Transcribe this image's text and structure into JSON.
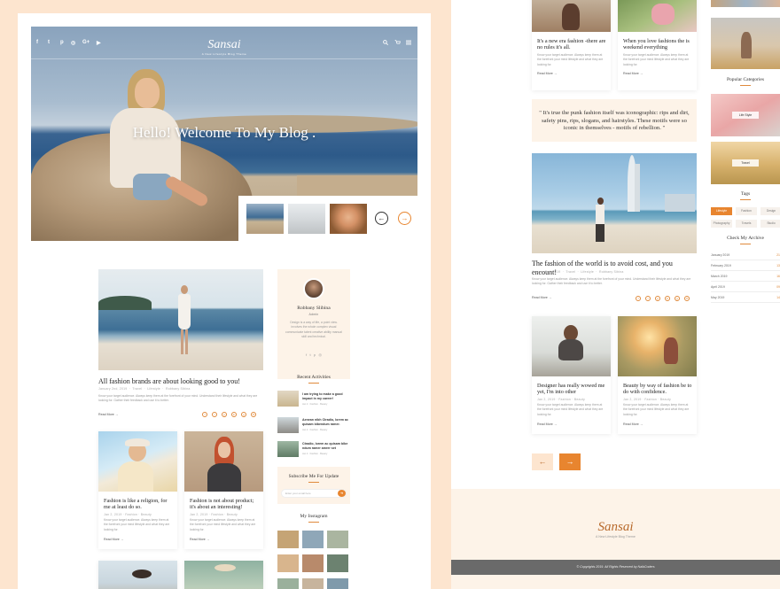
{
  "brand": {
    "logo": "Sansai",
    "tagline": "A New Lifestyle Blog Theme"
  },
  "colors": {
    "accent": "#e8852f",
    "peach": "#fde5cf",
    "cream": "#fdf3e8",
    "footer_bar": "#6a6a6a"
  },
  "header": {
    "social": [
      "f",
      "t",
      "p",
      "◎",
      "G+",
      "▶"
    ],
    "icons": [
      "search-icon",
      "cart-icon",
      "menu-icon"
    ],
    "cart_count": "0"
  },
  "hero": {
    "title": "Hello! Welcome To My Blog ."
  },
  "posts": {
    "p1": {
      "title": "All fashion brands are about looking good to you!",
      "meta": [
        "January 2nd, 2019",
        "Travel",
        "Lifestyle",
        "Robbany Sibina"
      ],
      "excerpt": "Know your target audience. Always keep them at the forefront of your mind. Understand their lifestyle and what they are looking for. Gather their feedback and use it to better.",
      "read_more": "Read More →",
      "share": [
        "f",
        "t",
        "p",
        "in",
        "g",
        "✉"
      ]
    },
    "c1": {
      "title": "Fashion is like a religion, for me at least do so.",
      "excerpt": "Know your target audience. Always keep them at the forefront your mind lifestyle and what they are looking for.",
      "read_more": "Read More →"
    },
    "c2": {
      "title": "Fashion is not about product; it's about an interesting!",
      "excerpt": "Know your target audience. Always keep them at the forefront your mind lifestyle and what they are looking for.",
      "read_more": "Read More →"
    },
    "r1": {
      "title": "It's a new era fashion -there are no rules it's all.",
      "excerpt": "Know your target audience. Always keep them at the forefront your mind lifestyle and what they are looking for.",
      "read_more": "Read More →"
    },
    "r2": {
      "title": "When you love fashions the is weekend everything",
      "excerpt": "Know your target audience. Always keep them at the forefront your mind lifestyle and what they are looking for.",
      "read_more": "Read More →"
    },
    "quote": "\" It's true the punk fashion itself was iconographic: rips and dirt, safety pins, rips, slogans, and hairstyles. These motifs were so iconic in themselves - motifs of rebellion. \"",
    "p2": {
      "title": "The fashion of the world is to avoid cost, and you encount!",
      "meta": [
        "January 2nd, 2019",
        "Travel",
        "Lifestyle",
        "Robbany Sibina"
      ],
      "excerpt": "Know your target audience. Always keep them at the forefront of your mind. Understand their lifestyle and what they are looking for. Gather their feedback and use it to better.",
      "read_more": "Read More →",
      "share": [
        "f",
        "t",
        "p",
        "in",
        "g",
        "✉"
      ]
    },
    "r3": {
      "title": "Designer has really wowed me yet, I'm into other",
      "excerpt": "Know your target audience. Always keep them at the forefront your mind lifestyle and what they are looking for.",
      "read_more": "Read More →"
    },
    "r4": {
      "title": "Beauty by way of fashion be to do with confidence.",
      "excerpt": "Know your target audience. Always keep them at the forefront your mind lifestyle and what they are looking for.",
      "read_more": "Read More →"
    }
  },
  "card_meta": [
    "Jan 2, 2019",
    "Fashion",
    "Beauty"
  ],
  "about": {
    "name": "Robbany Slibina",
    "role": "Admin",
    "bio": "Design is a way of life, a point view. involves the whole complex visual communicate talent creative ability manual skill and technical.",
    "social": [
      "f",
      "t",
      "p",
      "◎"
    ]
  },
  "recent": {
    "heading": "Recent Activities",
    "items": [
      {
        "title": "I am trying to make a good impact in my career!",
        "meta": "Jan 2 · Fashion · Beauty"
      },
      {
        "title": "Aenean nibh Ctradio, lorem ac quisam bibendum ramer.",
        "meta": "Jan 2 · Fashion · Beauty"
      },
      {
        "title": "Ctradio, lorem ac quisam bibe ndum ramer amrer set",
        "meta": "Jan 2 · Fashion · Beauty"
      }
    ]
  },
  "subscribe": {
    "heading": "Subscribe Me For Update",
    "placeholder": "Enter your email here",
    "button": "➜"
  },
  "instagram": {
    "heading": "My Instagram"
  },
  "categories": {
    "heading": "Popular Categories",
    "items": [
      "Life Style",
      "Travel"
    ]
  },
  "tags": {
    "heading": "Tags",
    "items": [
      "Lifestyle",
      "Fashion",
      "Design",
      "Photography",
      "Travels",
      "Studio"
    ]
  },
  "archive": {
    "heading": "Check My Archive",
    "rows": [
      {
        "label": "January 2019",
        "count": "21"
      },
      {
        "label": "February 2019",
        "count": "13"
      },
      {
        "label": "March 2019",
        "count": "16"
      },
      {
        "label": "April 2019",
        "count": "09"
      },
      {
        "label": "May 2019",
        "count": "14"
      }
    ]
  },
  "pagination": {
    "prev": "←",
    "next": "→"
  },
  "footer": {
    "logo": "Sansai",
    "tagline": "A New Lifestyle Blog Theme",
    "copyright": "© Copyrights 2019. All Rights Reserved by NaibCoders"
  }
}
